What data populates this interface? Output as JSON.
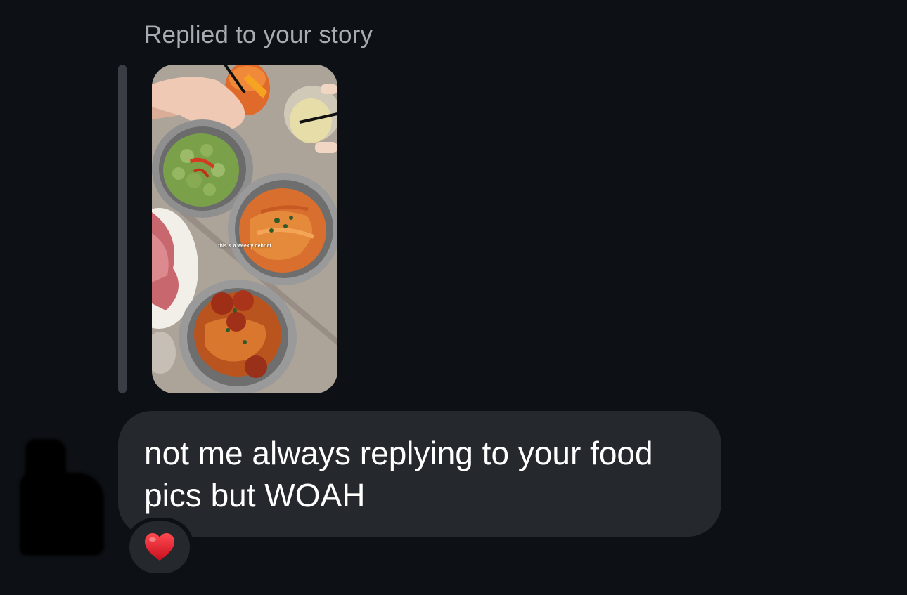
{
  "story_reply": {
    "label": "Replied to your story",
    "story_caption": "this & a weekly debrief"
  },
  "message": {
    "text": "not me always replying to your food pics but WOAH"
  },
  "reaction": {
    "icon": "red-heart-icon",
    "color": "#e0192b"
  },
  "colors": {
    "background": "#0d1015",
    "bubble": "#25282d",
    "label": "#a8acb2"
  }
}
